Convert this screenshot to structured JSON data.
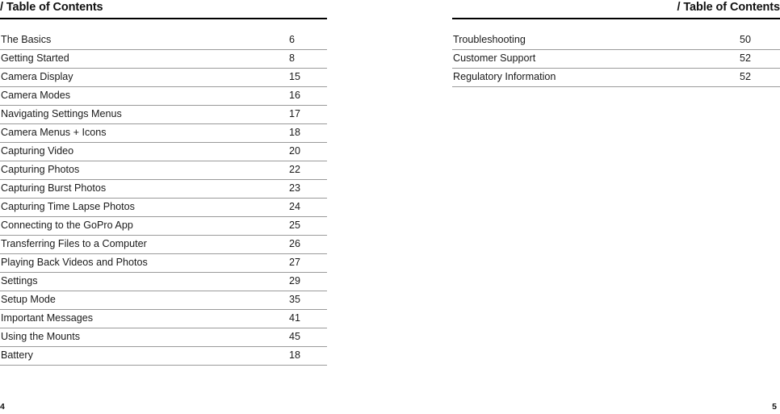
{
  "document": {
    "type": "table-of-contents",
    "background_color": "#ffffff",
    "text_color": "#1a1a1a",
    "rule_color": "#9a9a9a",
    "heavy_rule_color": "#000000"
  },
  "left_page": {
    "running_head": "/ Table of Contents",
    "folio": "4",
    "entries": [
      {
        "title": "The Basics",
        "page": "6"
      },
      {
        "title": "Getting Started",
        "page": "8"
      },
      {
        "title": "Camera Display",
        "page": "15"
      },
      {
        "title": "Camera Modes",
        "page": "16"
      },
      {
        "title": "Navigating Settings Menus",
        "page": "17"
      },
      {
        "title": "Camera Menus + Icons",
        "page": "18"
      },
      {
        "title": "Capturing Video",
        "page": "20"
      },
      {
        "title": "Capturing Photos",
        "page": "22"
      },
      {
        "title": "Capturing Burst Photos",
        "page": "23"
      },
      {
        "title": "Capturing Time Lapse Photos",
        "page": "24"
      },
      {
        "title": "Connecting to the GoPro App",
        "page": "25"
      },
      {
        "title": "Transferring Files to a Computer",
        "page": "26"
      },
      {
        "title": "Playing Back Videos and Photos",
        "page": "27"
      },
      {
        "title": "Settings",
        "page": "29"
      },
      {
        "title": "Setup Mode",
        "page": "35"
      },
      {
        "title": "Important Messages",
        "page": "41"
      },
      {
        "title": "Using the Mounts",
        "page": "45"
      },
      {
        "title": "Battery",
        "page": "18"
      }
    ]
  },
  "right_page": {
    "running_head": "/ Table of Contents",
    "folio": "5",
    "entries": [
      {
        "title": "Troubleshooting",
        "page": "50"
      },
      {
        "title": "Customer Support",
        "page": "52"
      },
      {
        "title": "Regulatory Information",
        "page": "52"
      }
    ]
  }
}
